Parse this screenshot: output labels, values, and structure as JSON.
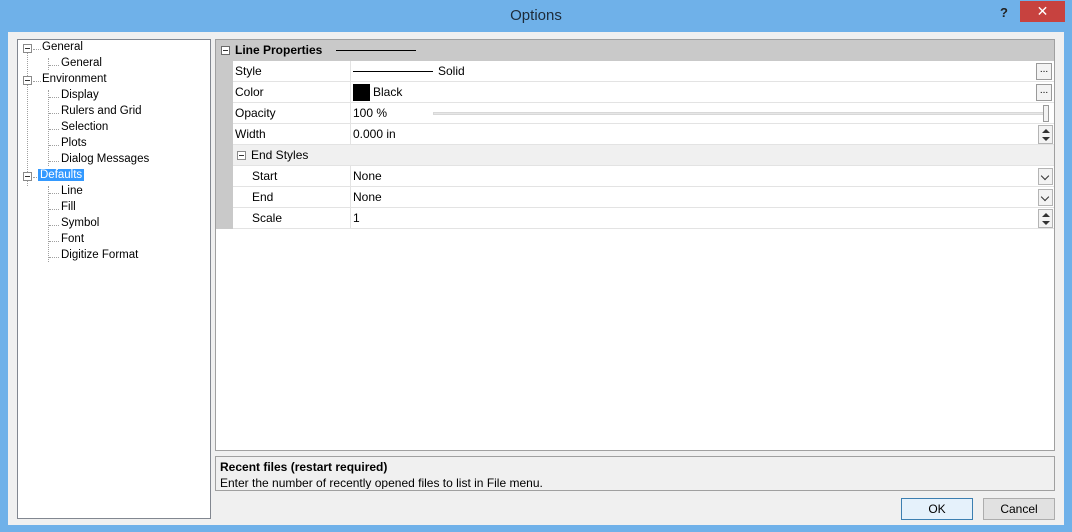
{
  "window": {
    "title": "Options",
    "help_label": "?",
    "close_label": "✕"
  },
  "tree": {
    "items": [
      {
        "label": "General"
      },
      {
        "label": "General"
      },
      {
        "label": "Environment"
      },
      {
        "label": "Display"
      },
      {
        "label": "Rulers and Grid"
      },
      {
        "label": "Selection"
      },
      {
        "label": "Plots"
      },
      {
        "label": "Dialog Messages"
      },
      {
        "label": "Defaults"
      },
      {
        "label": "Line"
      },
      {
        "label": "Fill"
      },
      {
        "label": "Symbol"
      },
      {
        "label": "Font"
      },
      {
        "label": "Digitize Format"
      }
    ],
    "selected": "Defaults"
  },
  "grid": {
    "category": "Line Properties",
    "rows": [
      {
        "name": "Style",
        "value": "Solid"
      },
      {
        "name": "Color",
        "value": "Black"
      },
      {
        "name": "Opacity",
        "value": "100 %",
        "level_percent": 100
      },
      {
        "name": "Width",
        "value": "0.000 in"
      }
    ],
    "subcategory": "End Styles",
    "subrows": [
      {
        "name": "Start",
        "value": "None"
      },
      {
        "name": "End",
        "value": "None"
      },
      {
        "name": "Scale",
        "value": "1"
      }
    ],
    "ellipsis_label": "...",
    "color_swatch": "#000000"
  },
  "description": {
    "title": "Recent files (restart required)",
    "text": "Enter the number of recently opened files to list in File menu."
  },
  "buttons": {
    "ok": "OK",
    "cancel": "Cancel"
  }
}
